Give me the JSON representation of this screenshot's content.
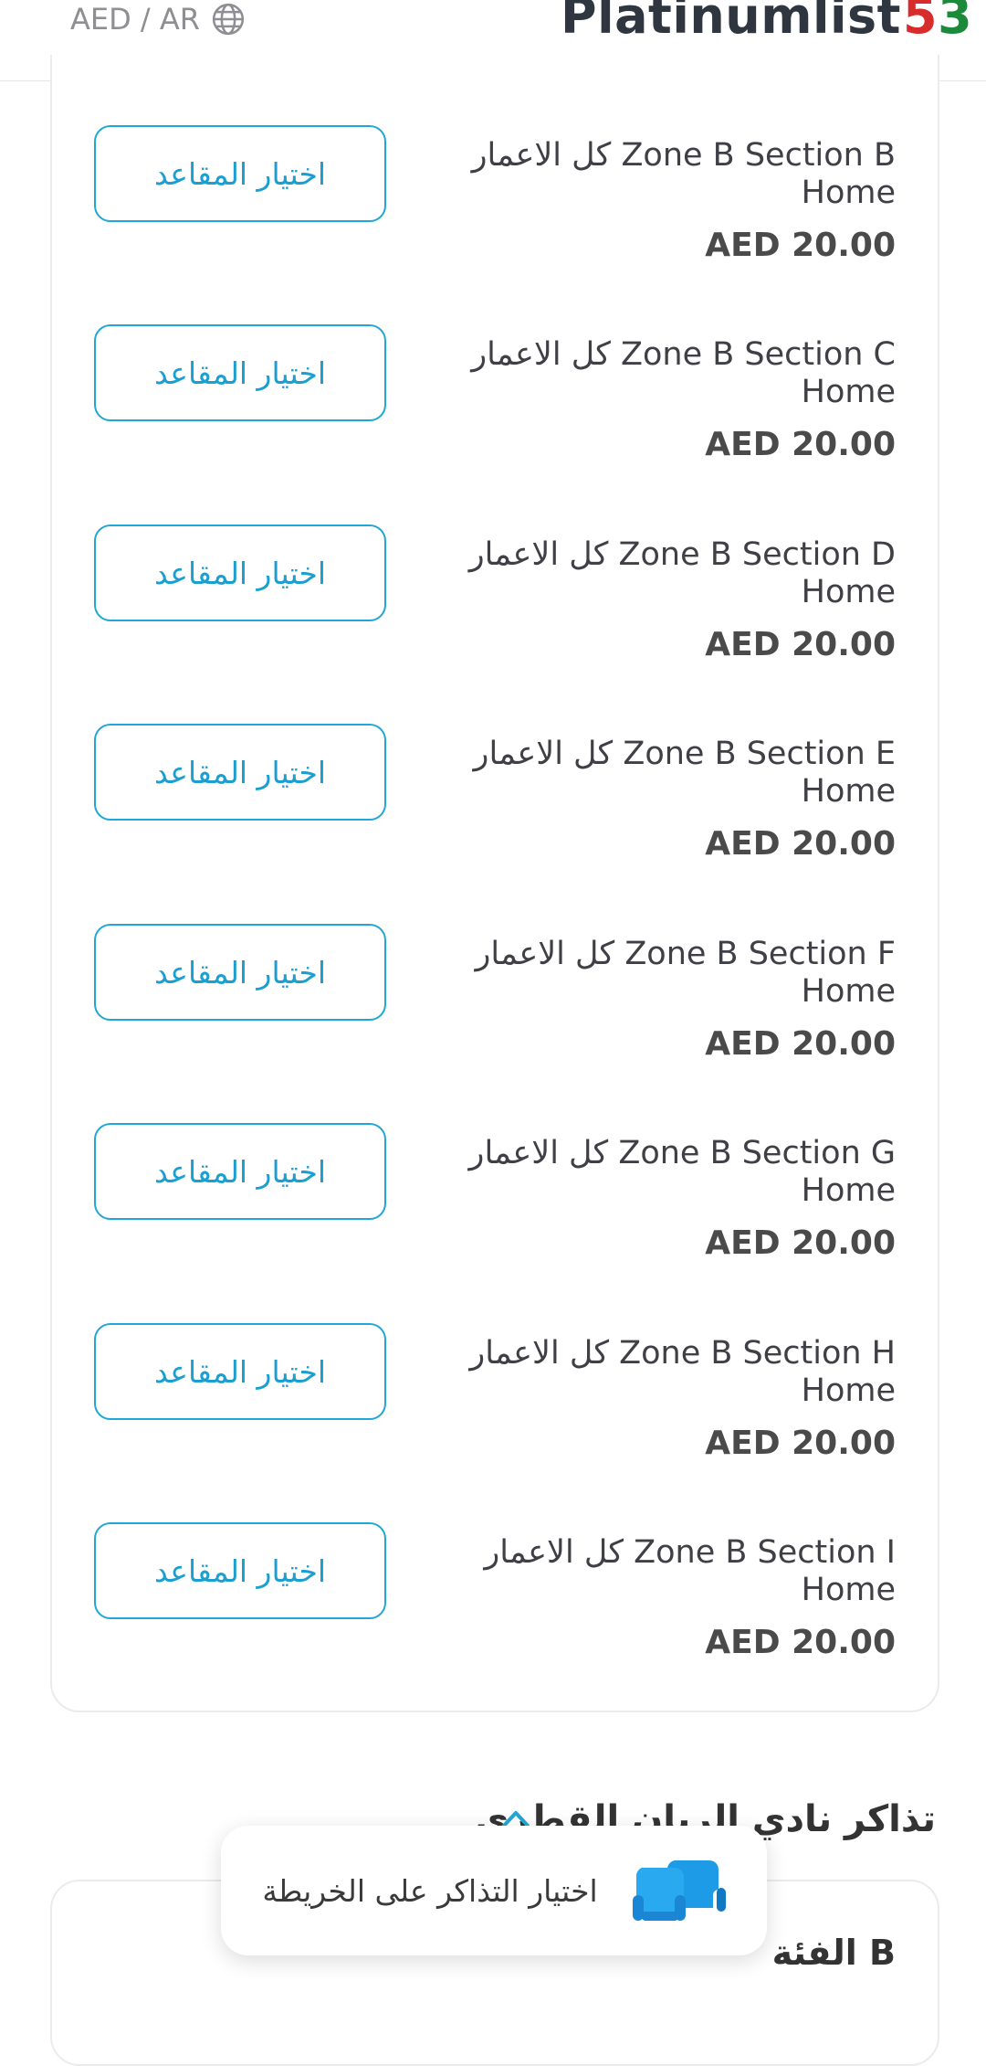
{
  "header": {
    "locale": "AED / AR",
    "brand": "Platinumlist",
    "brand_digit_1": "5",
    "brand_digit_2": "3"
  },
  "sections": [
    {
      "name": "كل الاعمار Zone B Section B Home",
      "price": "AED 20.00",
      "button": "اختيار المقاعد"
    },
    {
      "name": "كل الاعمار Zone B Section C Home",
      "price": "AED 20.00",
      "button": "اختيار المقاعد"
    },
    {
      "name": "كل الاعمار Zone B Section D Home",
      "price": "AED 20.00",
      "button": "اختيار المقاعد"
    },
    {
      "name": "كل الاعمار Zone B Section E Home",
      "price": "AED 20.00",
      "button": "اختيار المقاعد"
    },
    {
      "name": "كل الاعمار Zone B Section F Home",
      "price": "AED 20.00",
      "button": "اختيار المقاعد"
    },
    {
      "name": "كل الاعمار Zone B Section G Home",
      "price": "AED 20.00",
      "button": "اختيار المقاعد"
    },
    {
      "name": "كل الاعمار Zone B Section H Home",
      "price": "AED 20.00",
      "button": "اختيار المقاعد"
    },
    {
      "name": "كل الاعمار Zone B Section I Home",
      "price": "AED 20.00",
      "button": "اختيار المقاعد"
    }
  ],
  "next_section": {
    "title": "تذاكر نادي الريان القطري",
    "category": "الفئة B"
  },
  "map_pill": {
    "label": "اختيار التذاكر على الخريطة"
  },
  "colors": {
    "accent": "#1b9fd0",
    "price": "#4a4a4a",
    "icon_blue": "#1e9be6"
  }
}
